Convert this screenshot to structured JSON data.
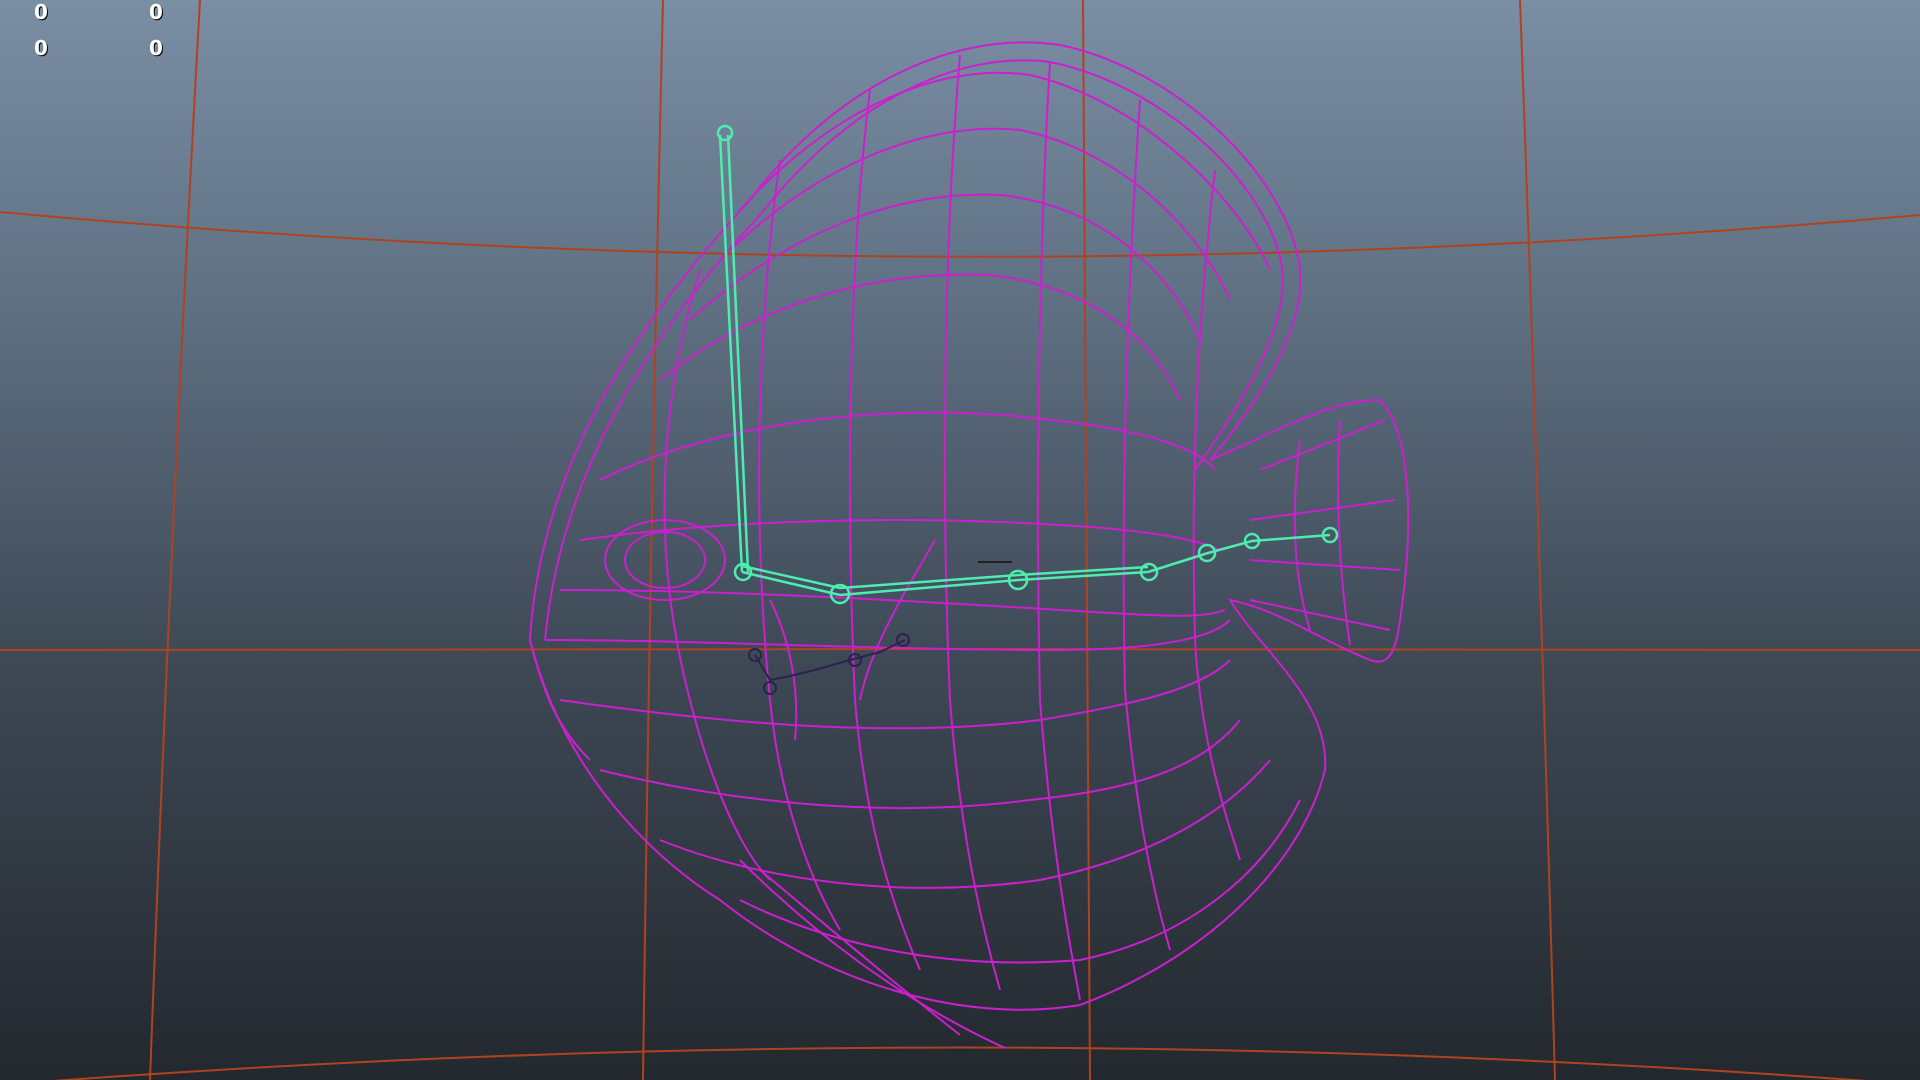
{
  "app": "3D viewport",
  "hud": {
    "row1_col1": "0",
    "row1_col2": "0",
    "row2_col1": "0",
    "row2_col2": "0"
  },
  "colors": {
    "grid": "#b0431f",
    "wireframe": "#cc1fd0",
    "skeleton": "#4dedb0",
    "secondary_joints": "#2a2350",
    "background_top": "#7a8ea4",
    "background_bottom": "#23282e"
  },
  "scene": {
    "object": "fish-wireframe-model",
    "skeleton_selected": true
  }
}
